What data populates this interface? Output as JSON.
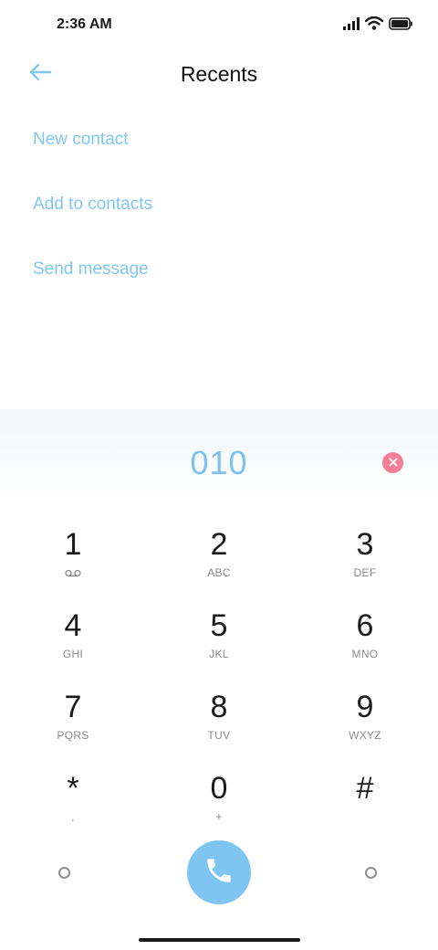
{
  "status_bar": {
    "time": "2:36 AM"
  },
  "header": {
    "title": "Recents"
  },
  "actions": [
    {
      "label": "New contact"
    },
    {
      "label": "Add to contacts"
    },
    {
      "label": "Send message"
    }
  ],
  "dialer": {
    "number": "010",
    "keys": [
      {
        "digit": "1",
        "letters": "",
        "sub_icon": "voicemail-icon"
      },
      {
        "digit": "2",
        "letters": "ABC"
      },
      {
        "digit": "3",
        "letters": "DEF"
      },
      {
        "digit": "4",
        "letters": "GHI"
      },
      {
        "digit": "5",
        "letters": "JKL"
      },
      {
        "digit": "6",
        "letters": "MNO"
      },
      {
        "digit": "7",
        "letters": "PQRS"
      },
      {
        "digit": "8",
        "letters": "TUV"
      },
      {
        "digit": "9",
        "letters": "WXYZ"
      },
      {
        "digit": "*",
        "letters": ","
      },
      {
        "digit": "0",
        "letters": "+"
      },
      {
        "digit": "#",
        "letters": ""
      }
    ]
  },
  "colors": {
    "accent": "#80c8f0",
    "number": "#7dc2ef",
    "call_button": "#7fc5f2",
    "clear_button": "#f47e95"
  },
  "icons": [
    "back-arrow-icon",
    "signal-icon",
    "wifi-icon",
    "battery-icon",
    "clear-icon",
    "voicemail-icon",
    "phone-icon"
  ]
}
